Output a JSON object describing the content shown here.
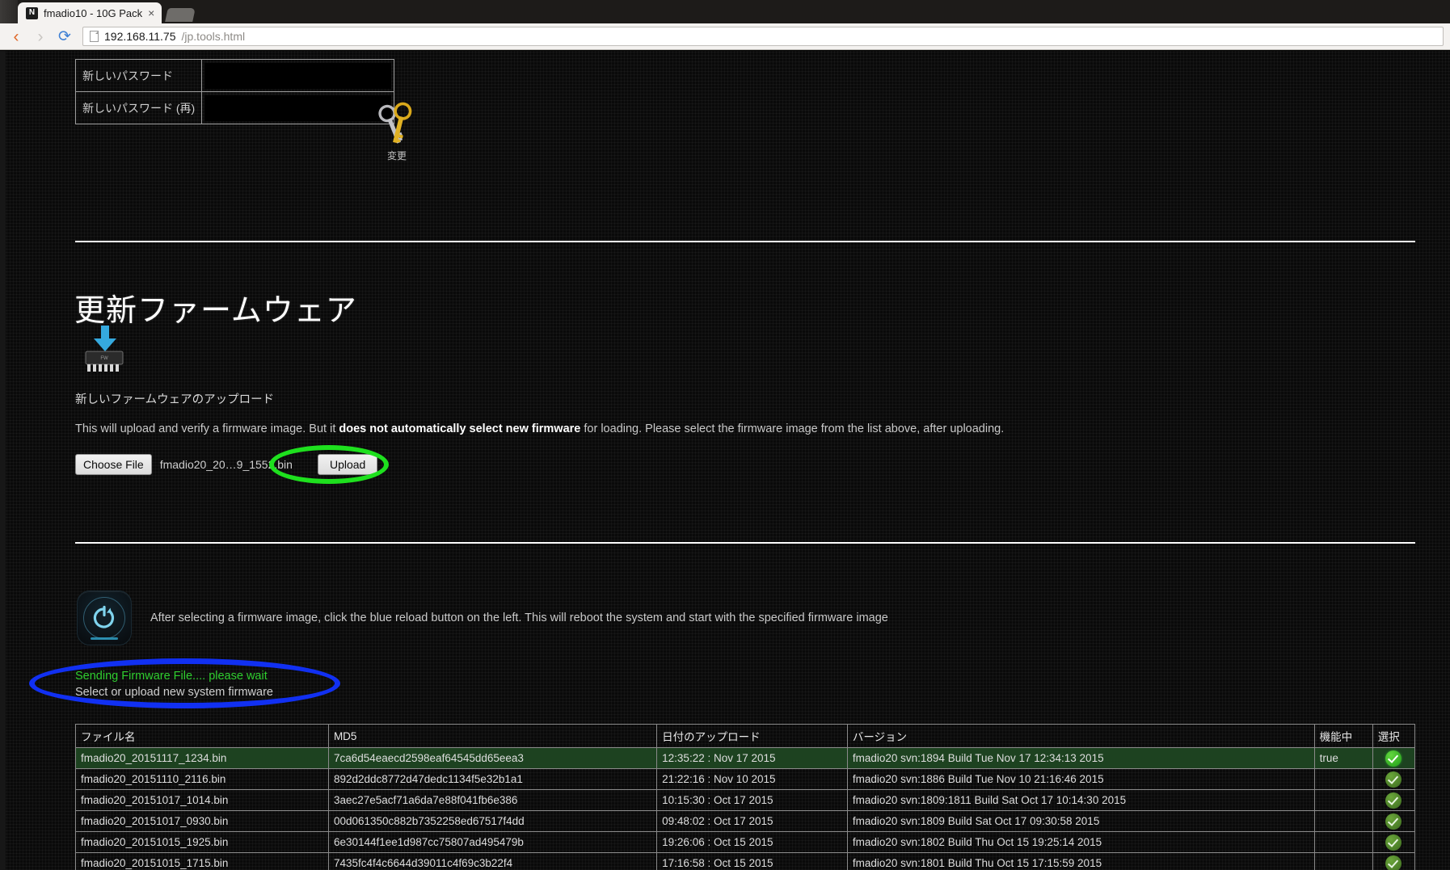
{
  "browser": {
    "tab": {
      "favicon_letter": "N",
      "title": "fmadio10 - 10G Pack",
      "close_label": "×"
    },
    "nav": {
      "back_glyph": "‹",
      "forward_glyph": "›",
      "reload_glyph": "⟳"
    },
    "url": {
      "host": "192.168.11.75",
      "path": "/jp.tools.html"
    }
  },
  "password_form": {
    "rows": [
      {
        "label": "新しいパスワード",
        "value": ""
      },
      {
        "label": "新しいパスワード (再)",
        "value": ""
      }
    ],
    "change_button_label": "変更",
    "keys_icon": "keys-icon"
  },
  "firmware": {
    "heading": "更新ファームウェア",
    "chip_icon": "firmware-chip-download-icon",
    "subtitle": "新しいファームウェアのアップロード",
    "description_pre": "This will upload and verify a firmware image. But it ",
    "description_bold": "does not automatically select new firmware",
    "description_post": " for loading. Please select the firmware image from the list above, after uploading.",
    "choose_file_label": "Choose File",
    "selected_file": "fmadio20_20…9_1552.bin",
    "upload_label": "Upload",
    "upload_highlight_color": "#1ee01e"
  },
  "reload_section": {
    "icon": "reload-power-icon",
    "text": "After selecting a firmware image, click the blue reload button on the left. This will reboot the system and start with the specified firmware image"
  },
  "status": {
    "sending_message": "Sending Firmware File.... please wait",
    "sending_color": "#2fce2f",
    "hint": "Select or upload new system firmware",
    "highlight_color": "#1130f2"
  },
  "firmware_table": {
    "headers": [
      "ファイル名",
      "MD5",
      "日付のアップロード",
      "バージョン",
      "機能中",
      "選択"
    ],
    "rows": [
      {
        "file": "fmadio20_20151117_1234.bin",
        "md5": "7ca6d54eaecd2598eaf64545dd65eea3",
        "date": "12:35:22 : Nov 17 2015",
        "version": "fmadio20 svn:1894 Build Tue Nov 17 12:34:13 2015",
        "active": "true",
        "selected": true
      },
      {
        "file": "fmadio20_20151110_2116.bin",
        "md5": "892d2ddc8772d47dedc1134f5e32b1a1",
        "date": "21:22:16 : Nov 10 2015",
        "version": "fmadio20 svn:1886 Build Tue Nov 10 21:16:46 2015",
        "active": "",
        "selected": false
      },
      {
        "file": "fmadio20_20151017_1014.bin",
        "md5": "3aec27e5acf71a6da7e88f041fb6e386",
        "date": "10:15:30 : Oct 17 2015",
        "version": "fmadio20 svn:1809:1811 Build Sat Oct 17 10:14:30 2015",
        "active": "",
        "selected": false
      },
      {
        "file": "fmadio20_20151017_0930.bin",
        "md5": "00d061350c882b7352258ed67517f4dd",
        "date": "09:48:02 : Oct 17 2015",
        "version": "fmadio20 svn:1809 Build Sat Oct 17 09:30:58 2015",
        "active": "",
        "selected": false
      },
      {
        "file": "fmadio20_20151015_1925.bin",
        "md5": "6e30144f1ee1d987cc75807ad495479b",
        "date": "19:26:06 : Oct 15 2015",
        "version": "fmadio20 svn:1802 Build Thu Oct 15 19:25:14 2015",
        "active": "",
        "selected": false
      },
      {
        "file": "fmadio20_20151015_1715.bin",
        "md5": "7435fc4f4c6644d39011c4f69c3b22f4",
        "date": "17:16:58 : Oct 15 2015",
        "version": "fmadio20 svn:1801 Build Thu Oct 15 17:15:59 2015",
        "active": "",
        "selected": false
      }
    ]
  }
}
